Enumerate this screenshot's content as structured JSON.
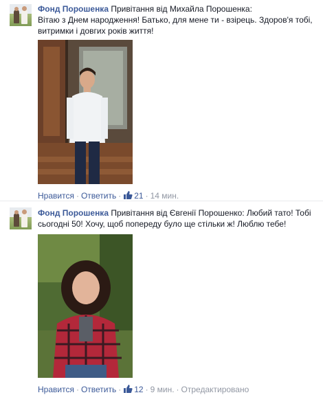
{
  "comments": [
    {
      "author": "Фонд Порошенка",
      "text_lines": [
        "Привітання від Михайла Порошенка:",
        "Вітаю з Днем народження! Батько, для мене ти - взірець. Здоров'я тобі,",
        "витримки і довгих років життя!"
      ],
      "photo_alt": "photo-boy-in-white-shirt",
      "actions": {
        "like_label": "Нравится",
        "reply_label": "Ответить",
        "likes_count": "21",
        "time": "14 мин."
      }
    },
    {
      "author": "Фонд Порошенка",
      "text_lines": [
        "Привітання від Євгенії Порошенко: Любий тато! Тобі",
        "сьогодні 50! Хочу, щоб попереду було ще стільки ж! Люблю тебе!"
      ],
      "photo_alt": "photo-girl-in-plaid-shirt",
      "actions": {
        "like_label": "Нравится",
        "reply_label": "Ответить",
        "likes_count": "12",
        "time": "9 мин.",
        "edited_label": "Отредактировано"
      }
    }
  ],
  "colors": {
    "link": "#3b5998",
    "meta": "#9197a3",
    "text": "#141823"
  },
  "icons": {
    "like": "thumbs-up-icon",
    "avatar": "fund-avatar"
  }
}
